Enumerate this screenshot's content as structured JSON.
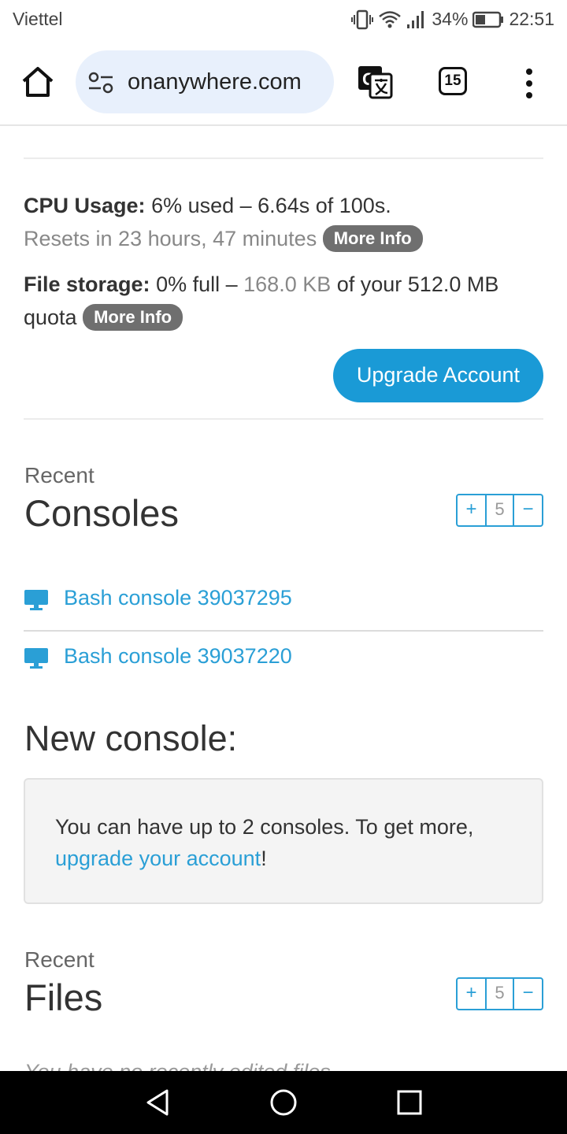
{
  "status_bar": {
    "carrier": "Viettel",
    "battery": "34%",
    "time": "22:51"
  },
  "browser": {
    "url": "onanywhere.com",
    "tab_count": "15"
  },
  "account": {
    "cpu_label": "CPU Usage:",
    "cpu_value": "6% used – 6.64s of 100s.",
    "reset_text": "Resets in 23 hours, 47 minutes",
    "more_info_1": "More Info",
    "storage_label": "File storage:",
    "storage_pre": "0% full –",
    "storage_used": "168.0 KB",
    "storage_post": "of your 512.0 MB",
    "storage_quota": "quota",
    "more_info_2": "More Info",
    "upgrade_button": "Upgrade Account"
  },
  "consoles": {
    "recent_label": "Recent",
    "title": "Consoles",
    "stepper_plus": "+",
    "stepper_value": "5",
    "stepper_minus": "−",
    "items": [
      {
        "label": "Bash console 39037295"
      },
      {
        "label": "Bash console 39037220"
      }
    ]
  },
  "new_console": {
    "title": "New console:",
    "message_pre": "You can have up to 2 consoles. To get more,",
    "message_link": "upgrade your account",
    "message_post": "!"
  },
  "files": {
    "recent_label": "Recent",
    "title": "Files",
    "stepper_plus": "+",
    "stepper_value": "5",
    "stepper_minus": "−",
    "empty_text": "You have no recently edited files."
  },
  "colors": {
    "accent": "#2a9fd6",
    "button": "#1a9ad6",
    "badge": "#6f6f6f"
  }
}
